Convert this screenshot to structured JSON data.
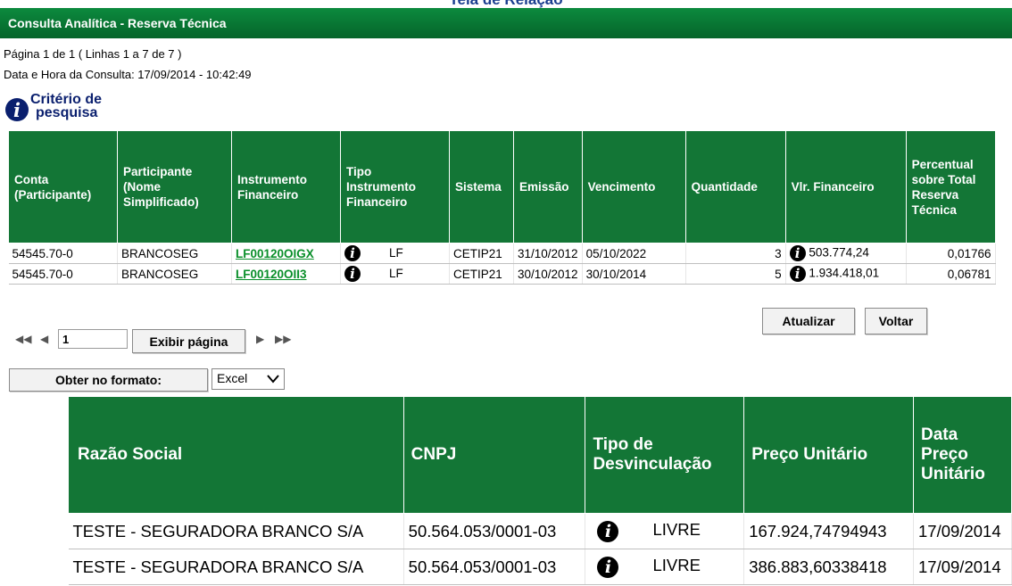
{
  "page": {
    "top_title": "Tela de Relação",
    "header_title": "Consulta Analítica - Reserva Técnica",
    "pagination_info": "Página 1 de 1 ( Linhas 1 a 7 de 7 )",
    "consult_datetime": "Data e Hora da Consulta: 17/09/2014 - 10:42:49",
    "criterio_line1": "Critério de",
    "criterio_line2": "pesquisa"
  },
  "table1": {
    "headers": [
      "Conta (Participante)",
      "Participante (Nome Simplificado)",
      "Instrumento Financeiro",
      "Tipo Instrumento Financeiro",
      "Sistema",
      "Emissão",
      "Vencimento",
      "Quantidade",
      "Vlr. Financeiro",
      "Percentual sobre Total Reserva Técnica"
    ],
    "rows": [
      {
        "conta": "54545.70-0",
        "participante": "BRANCOSEG",
        "instrumento": "LF00120OIGX",
        "tipo": "LF",
        "sistema": "CETIP21",
        "emissao": "31/10/2012",
        "vencimento": "05/10/2022",
        "quantidade": "3",
        "valor": "503.774,24",
        "percentual": "0,01766"
      },
      {
        "conta": "54545.70-0",
        "participante": "BRANCOSEG",
        "instrumento": "LF00120OII3",
        "tipo": "LF",
        "sistema": "CETIP21",
        "emissao": "30/10/2012",
        "vencimento": "30/10/2014",
        "quantidade": "5",
        "valor": "1.934.418,01",
        "percentual": "0,06781"
      }
    ]
  },
  "controls": {
    "page_value": "1",
    "show_page": "Exibir página",
    "update": "Atualizar",
    "back": "Voltar",
    "get_format": "Obter no formato:",
    "format_selected": "Excel",
    "first": "◀◀",
    "prev": "◀",
    "next": "▶",
    "last": "▶▶"
  },
  "table2": {
    "headers": [
      "Razão Social",
      "CNPJ",
      "Tipo de Desvinculação",
      "Preço Unitário",
      "Data Preço Unitário"
    ],
    "rows": [
      {
        "razao": "TESTE - SEGURADORA BRANCO S/A",
        "cnpj": "50.564.053/0001-03",
        "tipo": "LIVRE",
        "preco": "167.924,74794943",
        "data": "17/09/2014"
      },
      {
        "razao": "TESTE - SEGURADORA BRANCO S/A",
        "cnpj": "50.564.053/0001-03",
        "tipo": "LIVRE",
        "preco": "386.883,60338418",
        "data": "17/09/2014"
      }
    ]
  },
  "colors": {
    "header_green": "#137636",
    "link_green": "#0a8f2a",
    "title_blue": "#1a3d8f",
    "info_blue": "#0a1f6e"
  },
  "icons": {
    "info": "info-icon",
    "select_arrow": "chevron-down-icon"
  }
}
